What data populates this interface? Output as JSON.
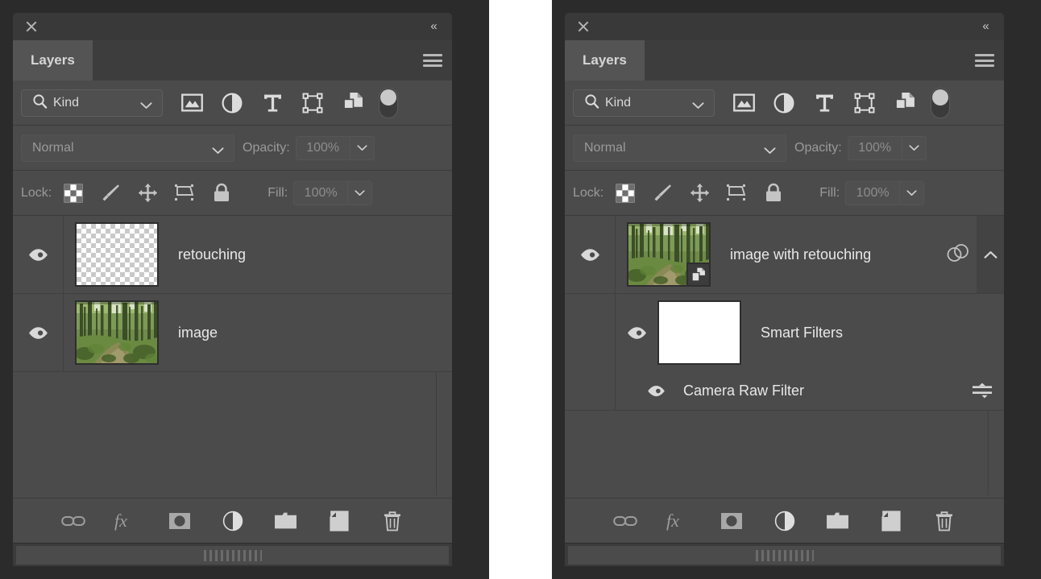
{
  "app": {
    "panel_title": "Layers",
    "close_icon": "close-icon",
    "collapse_icon": "collapse-double-chevron-icon",
    "menu_icon": "hamburger-menu-icon"
  },
  "filter_bar": {
    "kind_label": "Kind",
    "search_icon": "search-magnifier-icon",
    "chevron_icon": "chevron-down-icon",
    "icons": [
      {
        "name": "filter-pixel-layers-icon",
        "title": "Pixel layers"
      },
      {
        "name": "filter-adjustment-layers-icon",
        "title": "Adjustment layers"
      },
      {
        "name": "filter-type-layers-icon",
        "title": "Type layers"
      },
      {
        "name": "filter-shape-layers-icon",
        "title": "Shape layers"
      },
      {
        "name": "filter-smart-object-layers-icon",
        "title": "Smart objects"
      }
    ],
    "toggle_name": "filter-enable-toggle"
  },
  "blend_bar": {
    "blend_mode": "Normal",
    "opacity_label": "Opacity:",
    "opacity_value": "100%",
    "stepper_icon": "chevron-down-icon"
  },
  "lock_bar": {
    "lock_label": "Lock:",
    "fill_label": "Fill:",
    "fill_value": "100%",
    "icons": [
      {
        "name": "lock-transparent-pixels-icon"
      },
      {
        "name": "lock-image-pixels-brush-icon"
      },
      {
        "name": "lock-position-move-icon"
      },
      {
        "name": "lock-artboard-nesting-icon"
      },
      {
        "name": "lock-all-padlock-icon"
      }
    ]
  },
  "left_panel": {
    "layers": [
      {
        "name": "retouching",
        "visible": true,
        "thumb": "transparent-checker",
        "eye_icon": "eye-visibility-icon"
      },
      {
        "name": "image",
        "visible": true,
        "thumb": "forest-photo",
        "eye_icon": "eye-visibility-icon"
      }
    ]
  },
  "right_panel": {
    "layers": [
      {
        "name": "image with retouching",
        "visible": true,
        "thumb": "forest-photo",
        "badge": "smart-object-badge-icon",
        "eye_icon": "eye-visibility-icon",
        "smart_filter_icon": "smart-filters-overlapping-circles-icon",
        "collapse_icon": "chevron-up-icon"
      }
    ],
    "smart_filters": {
      "name": "Smart Filters",
      "visible": true,
      "mask_thumb": "white-mask",
      "eye_icon": "eye-visibility-icon",
      "filters": [
        {
          "name": "Camera Raw Filter",
          "visible": true,
          "eye_icon": "eye-visibility-icon",
          "options_icon": "filter-blending-options-icon"
        }
      ]
    }
  },
  "bottom_bar": {
    "icons": [
      {
        "name": "link-layers-icon"
      },
      {
        "name": "layer-style-fx-icon"
      },
      {
        "name": "add-layer-mask-icon"
      },
      {
        "name": "new-adjustment-layer-icon"
      },
      {
        "name": "new-group-folder-icon"
      },
      {
        "name": "new-layer-icon"
      },
      {
        "name": "delete-layer-trash-icon"
      }
    ]
  },
  "colors": {
    "panel_bg": "#4b4b4b",
    "titlebar_bg": "#393939",
    "tabbar_bg": "#3d3d3d",
    "tab_active_bg": "#545454",
    "outer_bg": "#2b2b2b",
    "text": "#e8e8e8",
    "muted_text": "#9a9a9a"
  }
}
